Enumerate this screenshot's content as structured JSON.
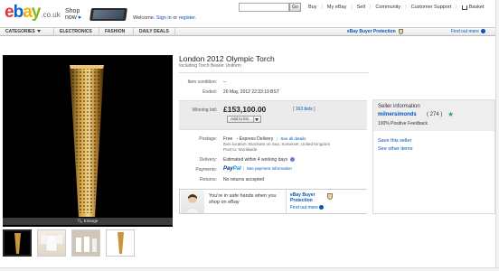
{
  "header": {
    "logo": {
      "e": "e",
      "b": "b",
      "a": "a",
      "y": "y",
      "domain": ".co.uk"
    },
    "promo": {
      "line1": "Shop",
      "line2": "now",
      "arrow": "▸"
    },
    "welcome": {
      "prefix": "Welcome. ",
      "signin": "Sign in",
      "or": " or ",
      "register": "register",
      "suffix": "."
    },
    "search_button": "Go",
    "nav": [
      "Buy",
      "My eBay",
      "Sell",
      "Community",
      "Customer Support"
    ],
    "basket": "Basket"
  },
  "categories": [
    "CATEGORIES",
    "ELECTRONICS",
    "FASHION",
    "DAILY DEALS"
  ],
  "buyer_protection": {
    "label": "eBay Buyer Protection",
    "find_out": "Find out more"
  },
  "listing": {
    "title": "London 2012 Olympic Torch",
    "subtitle": "Including Torch Bearer Uniform",
    "enlarge": "Enlarge",
    "fields": {
      "condition_label": "Item condition:",
      "condition_value": "--",
      "ended_label": "Ended:",
      "ended_value": "20 May, 2012 22:33:19 BST",
      "winning_label": "Winning bid:",
      "price": "£153,100.00",
      "bids": "[ 163 bids ]",
      "bids_open": "[ ",
      "bids_link": "163 bids",
      "bids_close": " ]",
      "add_to_list": "Add to list",
      "postage_label": "Postage:",
      "postage_value": "Free",
      "postage_method": "- Express Delivery",
      "postage_sep": "|",
      "see_all": "See all details",
      "item_location": "Item location: Burnham on Sea, Somerset, United Kingdom",
      "post_to": "Post to: Worldwide",
      "delivery_label": "Delivery:",
      "delivery_value": "Estimated within 4 working days",
      "payments_label": "Payments:",
      "paypal_pay": "Pay",
      "paypal_pal": "Pal",
      "payment_info": "See payment information",
      "payment_sep": "|",
      "returns_label": "Returns:",
      "returns_value": "No returns accepted"
    },
    "protection_banner": {
      "text": "You're in safe hands when you shop on eBay",
      "title": "eBay Buyer Protection",
      "link": "Find out more"
    }
  },
  "seller": {
    "title": "Seller information",
    "name": "milnersimonds",
    "score": "( 274 )",
    "positive": "100% Positive Feedback",
    "save": "Save this seller",
    "other": "See other items"
  },
  "colors": {
    "accent": "#0654ba",
    "ebay_red": "#e53238",
    "ebay_blue": "#0064d2",
    "ebay_yellow": "#f5af02",
    "ebay_green": "#86b817"
  },
  "icons": [
    "search-icon",
    "basket-icon",
    "shield-icon",
    "info-icon",
    "star-icon",
    "magnifier-icon"
  ]
}
